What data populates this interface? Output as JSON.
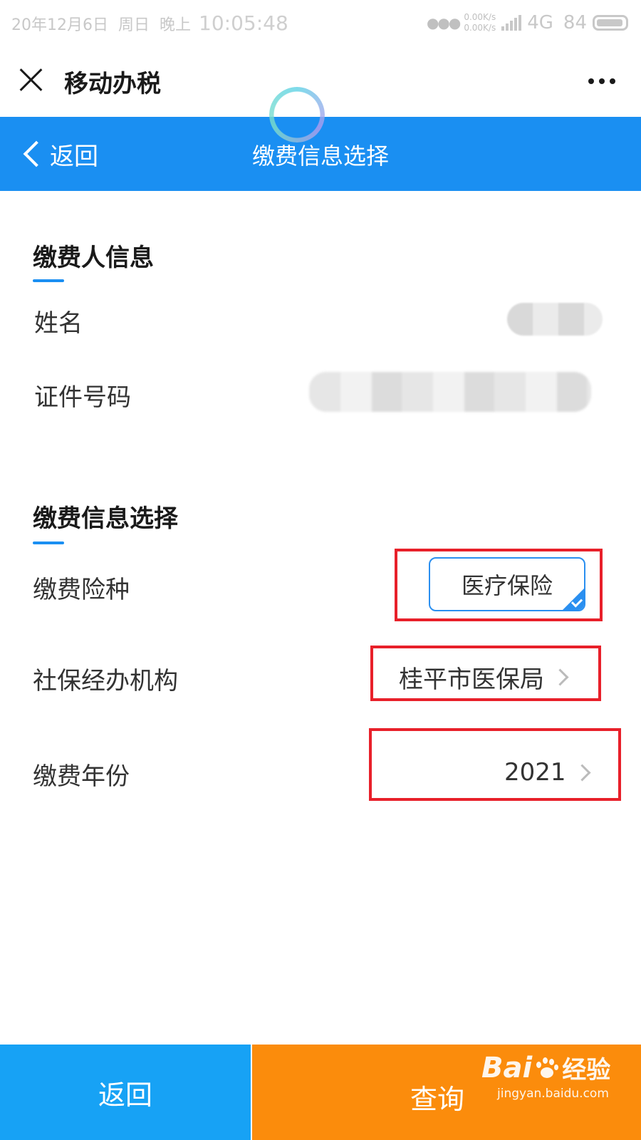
{
  "status_bar": {
    "date": "20年12月6日",
    "weekday": "周日",
    "period": "晚上",
    "time": "10:05:48",
    "net_up": "0.00K/s",
    "net_down": "0.00K/s",
    "network": "4G",
    "battery": "84"
  },
  "app_header": {
    "title": "移动办税"
  },
  "nav": {
    "back_label": "返回",
    "title": "缴费信息选择"
  },
  "payer_section": {
    "title": "缴费人信息",
    "name_label": "姓名",
    "id_label": "证件号码"
  },
  "payment_section": {
    "title": "缴费信息选择",
    "insurance_label": "缴费险种",
    "insurance_value": "医疗保险",
    "agency_label": "社保经办机构",
    "agency_value": "桂平市医保局",
    "year_label": "缴费年份",
    "year_value": "2021"
  },
  "footer": {
    "back_button": "返回",
    "query_button": "查询"
  },
  "watermark": {
    "brand_left": "Bai",
    "brand_right": "经验",
    "url": "jingyan.baidu.com"
  },
  "colors": {
    "primary_blue": "#1a8ff2",
    "query_orange": "#fb8c0c",
    "highlight_red": "#e8202a"
  }
}
